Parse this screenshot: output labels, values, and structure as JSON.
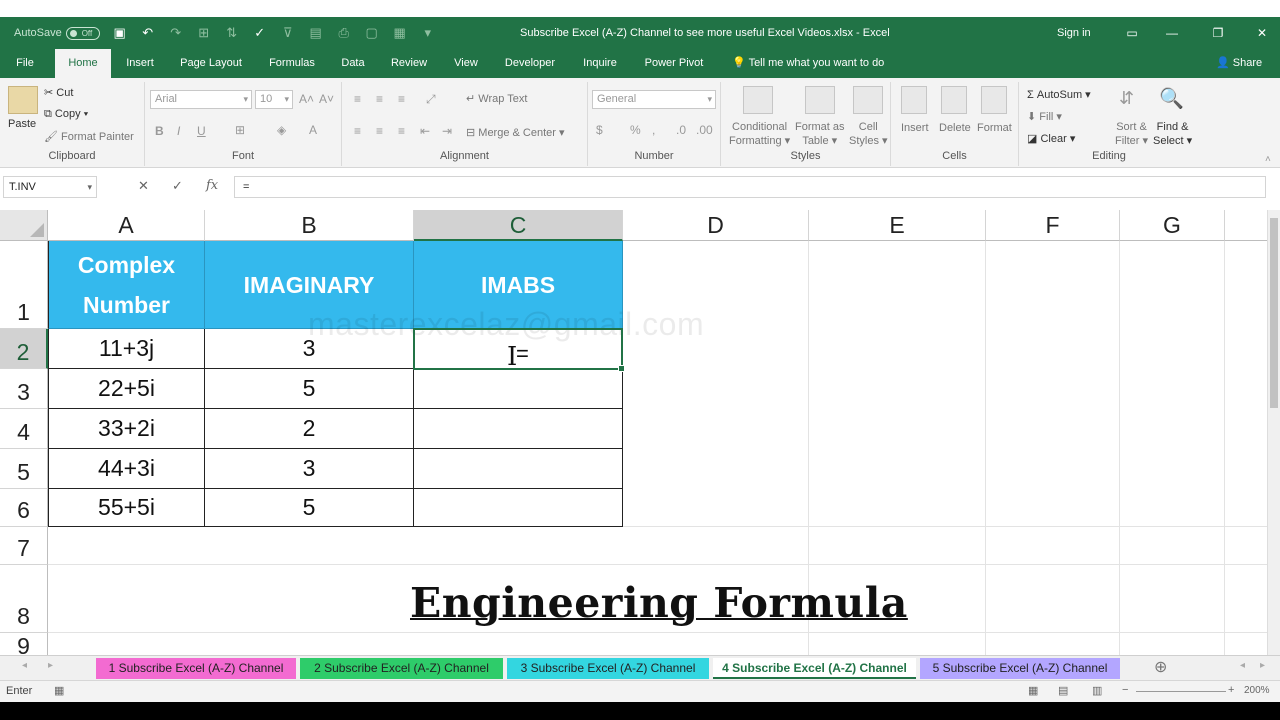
{
  "titlebar": {
    "autosave_label": "AutoSave",
    "autosave_state": "Off",
    "document_title": "Subscribe Excel (A-Z) Channel to see more useful Excel Videos.xlsx  -  Excel",
    "signin": "Sign in"
  },
  "tabs": [
    "File",
    "Home",
    "Insert",
    "Page Layout",
    "Formulas",
    "Data",
    "Review",
    "View",
    "Developer",
    "Inquire",
    "Power Pivot"
  ],
  "active_tab": "Home",
  "tellme": "Tell me what you want to do",
  "share": "Share",
  "ribbon": {
    "clipboard": {
      "paste": "Paste",
      "cut": "Cut",
      "copy": "Copy",
      "format_painter": "Format Painter",
      "label": "Clipboard"
    },
    "font": {
      "name": "Arial",
      "size": "10",
      "label": "Font",
      "bold": "B",
      "italic": "I",
      "underline": "U"
    },
    "alignment": {
      "wrap_text": "Wrap Text",
      "merge_center": "Merge & Center",
      "label": "Alignment"
    },
    "number": {
      "format": "General",
      "label": "Number",
      "percent": "%"
    },
    "styles": {
      "conditional": "Conditional",
      "formatting": "Formatting",
      "format_as": "Format as",
      "table": "Table",
      "cell": "Cell",
      "cell_styles": "Styles",
      "label": "Styles"
    },
    "cells": {
      "insert": "Insert",
      "delete": "Delete",
      "format": "Format",
      "label": "Cells"
    },
    "editing": {
      "autosum": "AutoSum",
      "fill": "Fill",
      "clear": "Clear",
      "sort_filter_1": "Sort &",
      "sort_filter_2": "Filter",
      "find_select_1": "Find &",
      "find_select_2": "Select",
      "label": "Editing"
    }
  },
  "formula_bar": {
    "name_box": "T.INV",
    "content": "="
  },
  "columns": [
    "A",
    "B",
    "C",
    "D",
    "E",
    "F",
    "G"
  ],
  "rows": [
    "1",
    "2",
    "3",
    "4",
    "5",
    "6",
    "7",
    "8",
    "9"
  ],
  "table": {
    "headers": [
      "Complex Number",
      "IMAGINARY",
      "IMABS"
    ],
    "header_color": "#34b9ed",
    "data": [
      [
        "11+3j",
        "3",
        ""
      ],
      [
        "22+5i",
        "5",
        ""
      ],
      [
        "33+2i",
        "2",
        ""
      ],
      [
        "44+3i",
        "3",
        ""
      ],
      [
        "55+5i",
        "5",
        ""
      ]
    ]
  },
  "editing_cell": "=",
  "watermark": "masterexcelaz@gmail.com",
  "sheet_heading": "Engineering Formula",
  "sheets": [
    {
      "name": "1 Subscribe Excel (A-Z) Channel",
      "color": "#f36bd1"
    },
    {
      "name": "2 Subscribe Excel (A-Z) Channel",
      "color": "#2ecc6a"
    },
    {
      "name": "3 Subscribe Excel (A-Z) Channel",
      "color": "#33d6e0"
    },
    {
      "name": "4 Subscribe Excel (A-Z) Channel",
      "color": "#ffffff"
    },
    {
      "name": "5 Subscribe Excel (A-Z) Channel",
      "color": "#b3a6ff"
    }
  ],
  "active_sheet": "4 Subscribe Excel (A-Z) Channel",
  "status": {
    "mode": "Enter",
    "zoom": "200%"
  },
  "accent": "#217346"
}
